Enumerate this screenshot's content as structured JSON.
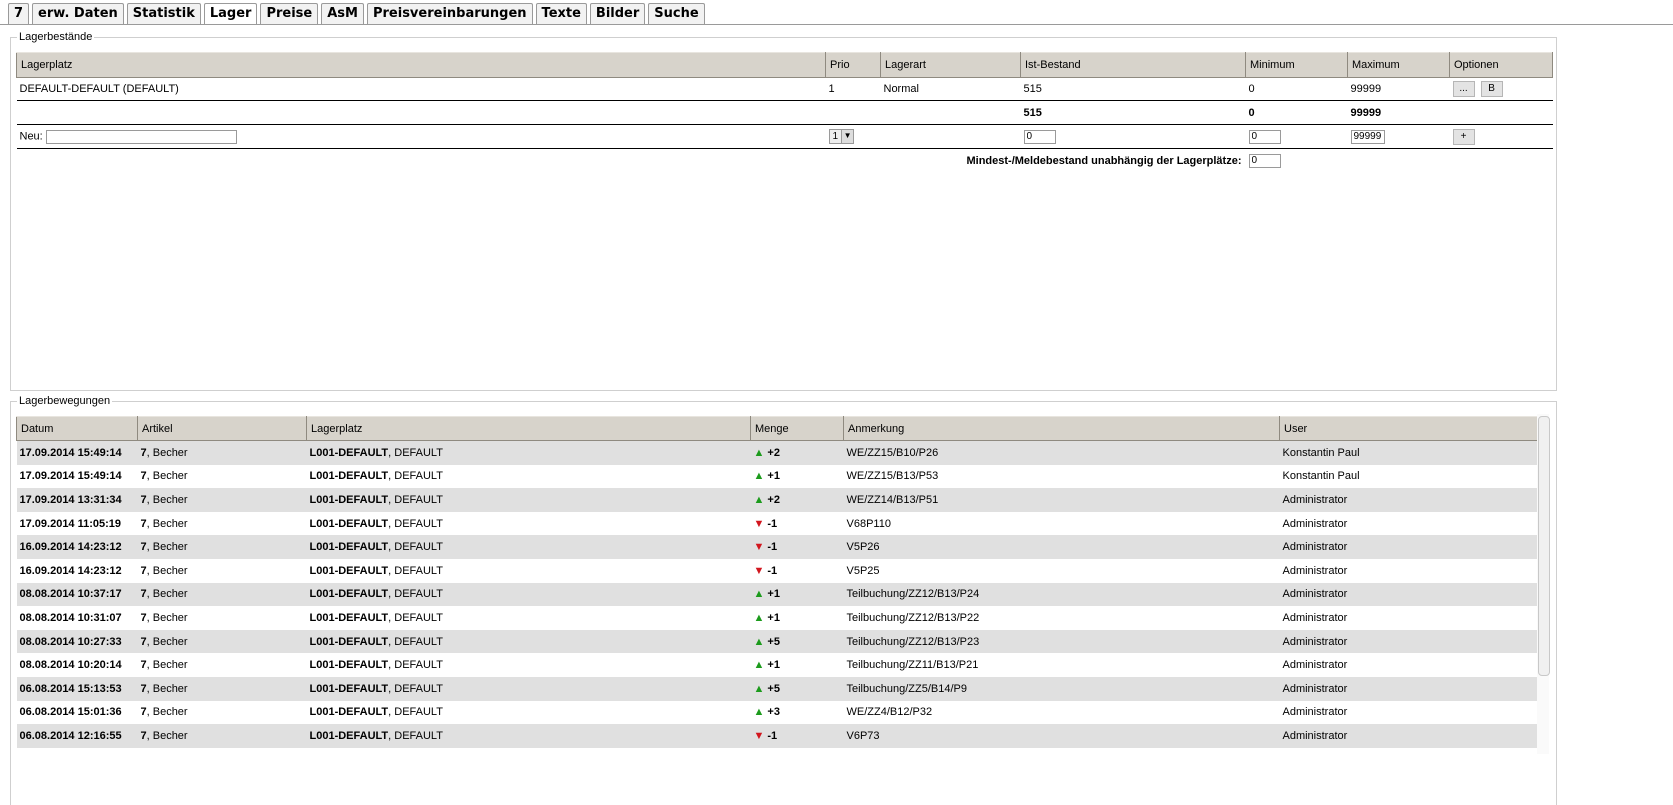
{
  "tabs": [
    "7",
    "erw. Daten",
    "Statistik",
    "Lager",
    "Preise",
    "AsM",
    "Preisvereinbarungen",
    "Texte",
    "Bilder",
    "Suche"
  ],
  "active_tab": "Lager",
  "stock": {
    "legend": "Lagerbestände",
    "headers": [
      "Lagerplatz",
      "Prio",
      "Lagerart",
      "Ist-Bestand",
      "Minimum",
      "Maximum",
      "Optionen"
    ],
    "row": {
      "lagerplatz": "DEFAULT-DEFAULT (DEFAULT)",
      "prio": "1",
      "lagerart": "Normal",
      "ist": "515",
      "min": "0",
      "max": "99999",
      "btn_dots": "...",
      "btn_b": "B"
    },
    "totals": {
      "ist": "515",
      "min": "0",
      "max": "99999"
    },
    "new_row": {
      "label": "Neu:",
      "name_value": "",
      "prio_value": "1",
      "ist_value": "0",
      "min_value": "0",
      "max_value": "99999",
      "add_label": "+"
    },
    "mindest_label": "Mindest-/Meldebestand unabhängig der Lagerplätze:",
    "mindest_value": "0"
  },
  "movements": {
    "legend": "Lagerbewegungen",
    "headers": [
      "Datum",
      "Artikel",
      "Lagerplatz",
      "Menge",
      "Anmerkung",
      "User"
    ],
    "rows": [
      {
        "datum": "17.09.2014 15:49:14",
        "art_bold": "7",
        "art_rest": ", Becher",
        "lp_bold": "L001-DEFAULT",
        "lp_rest": ", DEFAULT",
        "dir": "up",
        "menge": "+2",
        "anm": "WE/ZZ15/B10/P26",
        "user": "Konstantin Paul"
      },
      {
        "datum": "17.09.2014 15:49:14",
        "art_bold": "7",
        "art_rest": ", Becher",
        "lp_bold": "L001-DEFAULT",
        "lp_rest": ", DEFAULT",
        "dir": "up",
        "menge": "+1",
        "anm": "WE/ZZ15/B13/P53",
        "user": "Konstantin Paul"
      },
      {
        "datum": "17.09.2014 13:31:34",
        "art_bold": "7",
        "art_rest": ", Becher",
        "lp_bold": "L001-DEFAULT",
        "lp_rest": ", DEFAULT",
        "dir": "up",
        "menge": "+2",
        "anm": "WE/ZZ14/B13/P51",
        "user": "Administrator"
      },
      {
        "datum": "17.09.2014 11:05:19",
        "art_bold": "7",
        "art_rest": ", Becher",
        "lp_bold": "L001-DEFAULT",
        "lp_rest": ", DEFAULT",
        "dir": "down",
        "menge": "-1",
        "anm": "V68P110",
        "user": "Administrator"
      },
      {
        "datum": "16.09.2014 14:23:12",
        "art_bold": "7",
        "art_rest": ", Becher",
        "lp_bold": "L001-DEFAULT",
        "lp_rest": ", DEFAULT",
        "dir": "down",
        "menge": "-1",
        "anm": "V5P26",
        "user": "Administrator"
      },
      {
        "datum": "16.09.2014 14:23:12",
        "art_bold": "7",
        "art_rest": ", Becher",
        "lp_bold": "L001-DEFAULT",
        "lp_rest": ", DEFAULT",
        "dir": "down",
        "menge": "-1",
        "anm": "V5P25",
        "user": "Administrator"
      },
      {
        "datum": "08.08.2014 10:37:17",
        "art_bold": "7",
        "art_rest": ", Becher",
        "lp_bold": "L001-DEFAULT",
        "lp_rest": ", DEFAULT",
        "dir": "up",
        "menge": "+1",
        "anm": "Teilbuchung/ZZ12/B13/P24",
        "user": "Administrator"
      },
      {
        "datum": "08.08.2014 10:31:07",
        "art_bold": "7",
        "art_rest": ", Becher",
        "lp_bold": "L001-DEFAULT",
        "lp_rest": ", DEFAULT",
        "dir": "up",
        "menge": "+1",
        "anm": "Teilbuchung/ZZ12/B13/P22",
        "user": "Administrator"
      },
      {
        "datum": "08.08.2014 10:27:33",
        "art_bold": "7",
        "art_rest": ", Becher",
        "lp_bold": "L001-DEFAULT",
        "lp_rest": ", DEFAULT",
        "dir": "up",
        "menge": "+5",
        "anm": "Teilbuchung/ZZ12/B13/P23",
        "user": "Administrator"
      },
      {
        "datum": "08.08.2014 10:20:14",
        "art_bold": "7",
        "art_rest": ", Becher",
        "lp_bold": "L001-DEFAULT",
        "lp_rest": ", DEFAULT",
        "dir": "up",
        "menge": "+1",
        "anm": "Teilbuchung/ZZ11/B13/P21",
        "user": "Administrator"
      },
      {
        "datum": "06.08.2014 15:13:53",
        "art_bold": "7",
        "art_rest": ", Becher",
        "lp_bold": "L001-DEFAULT",
        "lp_rest": ", DEFAULT",
        "dir": "up",
        "menge": "+5",
        "anm": "Teilbuchung/ZZ5/B14/P9",
        "user": "Administrator"
      },
      {
        "datum": "06.08.2014 15:01:36",
        "art_bold": "7",
        "art_rest": ", Becher",
        "lp_bold": "L001-DEFAULT",
        "lp_rest": ", DEFAULT",
        "dir": "up",
        "menge": "+3",
        "anm": "WE/ZZ4/B12/P32",
        "user": "Administrator"
      },
      {
        "datum": "06.08.2014 12:16:55",
        "art_bold": "7",
        "art_rest": ", Becher",
        "lp_bold": "L001-DEFAULT",
        "lp_rest": ", DEFAULT",
        "dir": "down",
        "menge": "-1",
        "anm": "V6P73",
        "user": "Administrator"
      }
    ]
  },
  "icons": {
    "up": "triangle-up-icon",
    "down": "triangle-down-icon",
    "select_arrow": "chevron-down-icon"
  },
  "colors": {
    "up": "#1c9b1c",
    "down": "#d2161e",
    "header_bg": "#d7d3cb",
    "row_alt": "#e0e0e0"
  }
}
